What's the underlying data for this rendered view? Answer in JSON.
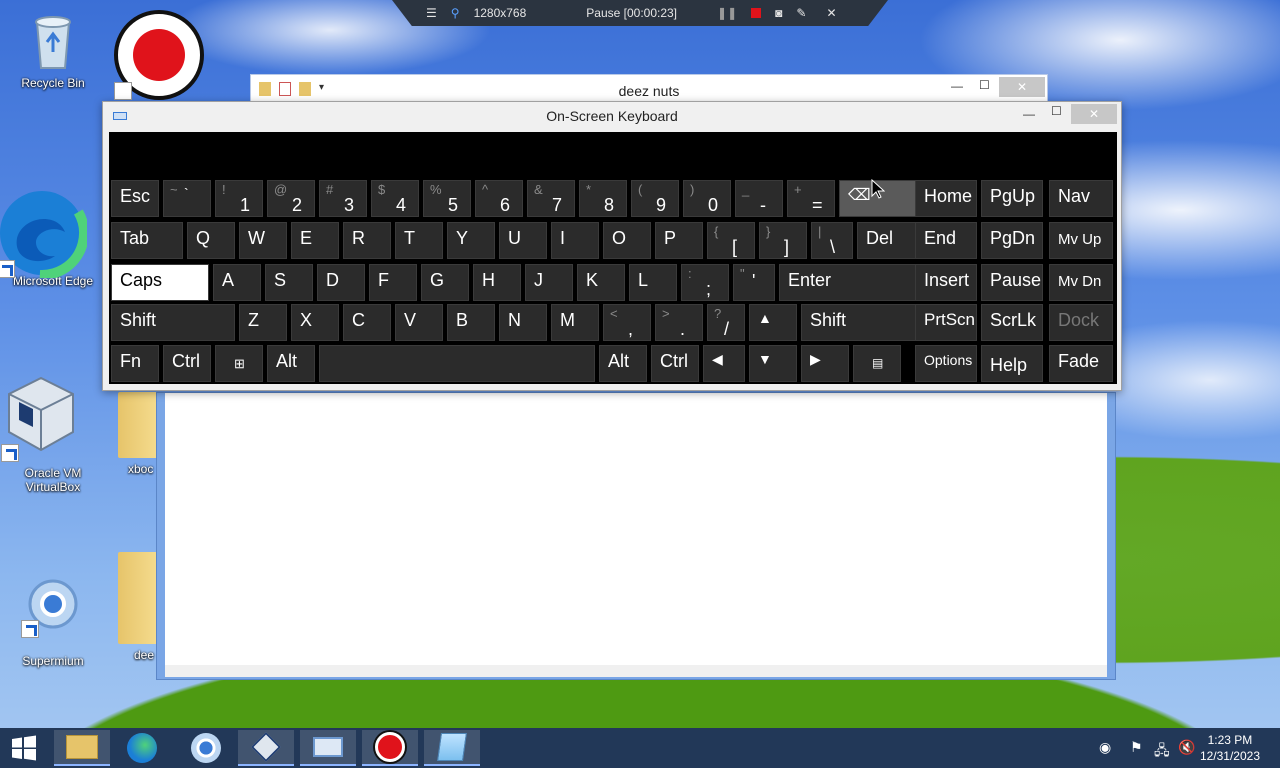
{
  "recorder_bar": {
    "resolution": "1280x768",
    "status": "Pause [00:00:23]"
  },
  "desktop": {
    "icons": [
      {
        "label": "Recycle Bin"
      },
      {
        "label": "Microsoft Edge"
      },
      {
        "label": "Oracle VM\nVirtualBox"
      },
      {
        "label": "Supermium"
      },
      {
        "label": "xboc"
      },
      {
        "label": "dee"
      }
    ]
  },
  "notepad": {
    "title": "deez nuts"
  },
  "osk": {
    "title": "On-Screen Keyboard",
    "rows": {
      "row1": [
        {
          "label": "Esc"
        },
        {
          "shift": "~",
          "main": "`"
        },
        {
          "shift": "!",
          "main": "1"
        },
        {
          "shift": "@",
          "main": "2"
        },
        {
          "shift": "#",
          "main": "3"
        },
        {
          "shift": "$",
          "main": "4"
        },
        {
          "shift": "%",
          "main": "5"
        },
        {
          "shift": "^",
          "main": "6"
        },
        {
          "shift": "&",
          "main": "7"
        },
        {
          "shift": "*",
          "main": "8"
        },
        {
          "shift": "(",
          "main": "9"
        },
        {
          "shift": ")",
          "main": "0"
        },
        {
          "shift": "_",
          "main": "-"
        },
        {
          "shift": "+",
          "main": "="
        }
      ],
      "row2": [
        "Tab",
        "Q",
        "W",
        "E",
        "R",
        "T",
        "Y",
        "U",
        "I",
        "O",
        "P"
      ],
      "row2_sym": [
        {
          "shift": "{",
          "main": "["
        },
        {
          "shift": "}",
          "main": "]"
        },
        {
          "shift": "|",
          "main": "\\"
        }
      ],
      "row2_end": "Del",
      "row3": [
        "Caps",
        "A",
        "S",
        "D",
        "F",
        "G",
        "H",
        "J",
        "K",
        "L"
      ],
      "row3_sym": [
        {
          "shift": ":",
          "main": ";"
        },
        {
          "shift": "\"",
          "main": "'"
        }
      ],
      "row3_end": "Enter",
      "row4_start": "Shift",
      "row4": [
        "Z",
        "X",
        "C",
        "V",
        "B",
        "N",
        "M"
      ],
      "row4_sym": [
        {
          "shift": "<",
          "main": ","
        },
        {
          "shift": ">",
          "main": "."
        },
        {
          "shift": "?",
          "main": "/"
        }
      ],
      "row4_end": "Shift",
      "row5": [
        "Fn",
        "Ctrl",
        "",
        "Alt",
        "",
        "Alt",
        "Ctrl"
      ],
      "nav": [
        "Home",
        "PgUp",
        "Nav",
        "End",
        "PgDn",
        "Mv Up",
        "Insert",
        "Pause",
        "Mv Dn",
        "PrtScn",
        "ScrLk",
        "Dock",
        "Options",
        "Help",
        "Fade"
      ]
    }
  },
  "taskbar": {
    "time": "1:23 PM",
    "date": "12/31/2023"
  }
}
